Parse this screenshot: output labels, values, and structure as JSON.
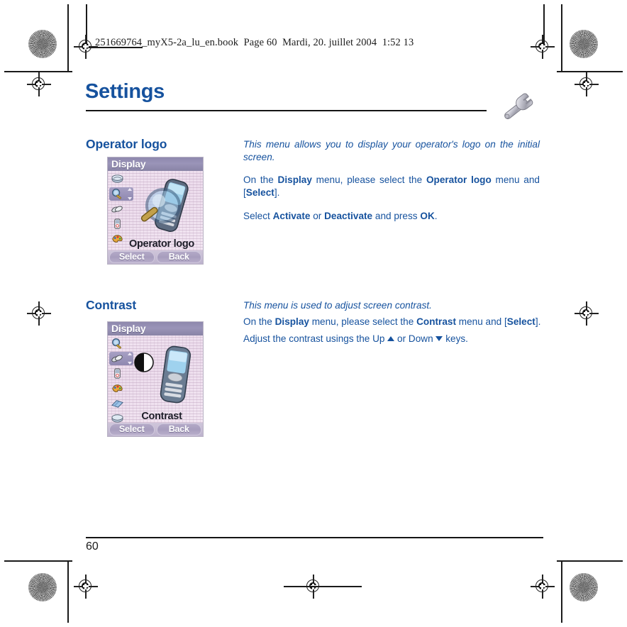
{
  "document": {
    "file_header": "251669764_myX5-2a_lu_en.book  Page 60  Mardi, 20. juillet 2004  1:52 13",
    "title": "Settings",
    "title_icon": "wrench-icon",
    "page_number": "60"
  },
  "sections": [
    {
      "heading": "Operator logo",
      "screenshot": {
        "titlebar": "Display",
        "caption": "Operator logo",
        "hero_icon": "magnifier-over-phone-icon",
        "softkey_left": "Select",
        "softkey_right": "Back",
        "icons": [
          "wallpaper-icon",
          "magnifier-icon",
          "screensaver-icon",
          "backlight-icon",
          "palette-icon",
          "operator-logo-icon"
        ]
      },
      "paragraphs": [
        {
          "style": "italic",
          "runs": [
            {
              "text": "This menu allows you to display your operator's logo on the initial screen.",
              "bold": false
            }
          ]
        },
        {
          "style": "normal",
          "runs": [
            {
              "text": "On the ",
              "bold": false
            },
            {
              "text": "Display",
              "bold": true
            },
            {
              "text": " menu, please select the ",
              "bold": false
            },
            {
              "text": "Operator logo",
              "bold": true
            },
            {
              "text": " menu and [",
              "bold": false
            },
            {
              "text": "Select",
              "bold": true
            },
            {
              "text": "].",
              "bold": false
            }
          ]
        },
        {
          "style": "normal",
          "runs": [
            {
              "text": "Select ",
              "bold": false
            },
            {
              "text": "Activate",
              "bold": true
            },
            {
              "text": " or ",
              "bold": false
            },
            {
              "text": "Deactivate",
              "bold": true
            },
            {
              "text": " and press ",
              "bold": false
            },
            {
              "text": "OK",
              "bold": true
            },
            {
              "text": ".",
              "bold": false
            }
          ]
        }
      ]
    },
    {
      "heading": "Contrast",
      "screenshot": {
        "titlebar": "Display",
        "caption": "Contrast",
        "hero_icon": "contrast-circle-and-phone-icon",
        "softkey_left": "Select",
        "softkey_right": "Back",
        "icons": [
          "magnifier-icon",
          "contrast-icon",
          "backlight-icon",
          "palette-icon",
          "operator-logo-icon",
          "wallpaper-icon"
        ]
      },
      "paragraphs": [
        {
          "style": "italic",
          "runs": [
            {
              "text": "This menu is used to adjust screen contrast.",
              "bold": false
            }
          ]
        },
        {
          "style": "normal",
          "runs": [
            {
              "text": "On the ",
              "bold": false
            },
            {
              "text": "Display",
              "bold": true
            },
            {
              "text": " menu, please select the ",
              "bold": false
            },
            {
              "text": "Contrast",
              "bold": true
            },
            {
              "text": " menu and [",
              "bold": false
            },
            {
              "text": "Select",
              "bold": true
            },
            {
              "text": "].",
              "bold": false
            }
          ]
        },
        {
          "style": "normal",
          "runs": [
            {
              "text": "Adjust the contrast usings the Up ",
              "bold": false
            },
            {
              "glyph": "up-triangle"
            },
            {
              "text": " or Down ",
              "bold": false
            },
            {
              "glyph": "down-triangle"
            },
            {
              "text": " keys.",
              "bold": false
            }
          ]
        }
      ]
    }
  ],
  "colors": {
    "brand_blue": "#16529e",
    "ink_black": "#1a1a1a",
    "phone_titlebar": "#9a94b8",
    "phone_bg": "#ecdfec"
  },
  "print_marks": {
    "targets": "registration-crosshair",
    "starbursts": "star-target"
  }
}
